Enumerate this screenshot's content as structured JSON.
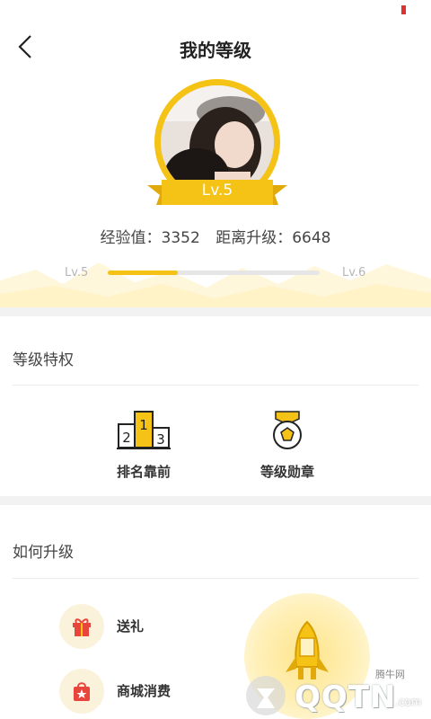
{
  "nav": {
    "title": "我的等级"
  },
  "profile": {
    "badge_level": "Lv.5"
  },
  "experience": {
    "exp_label": "经验值：3352",
    "remaining_label": "距离升级：6648",
    "current_level": "Lv.5",
    "next_level": "Lv.6",
    "progress_fraction": 0.33
  },
  "privileges": {
    "title": "等级特权",
    "items": [
      {
        "label": "排名靠前",
        "icon": "podium-icon"
      },
      {
        "label": "等级勋章",
        "icon": "medal-icon"
      }
    ],
    "podium_numbers": [
      "1",
      "2",
      "3"
    ]
  },
  "upgrade": {
    "title": "如何升级",
    "items": [
      {
        "label": "送礼",
        "icon": "gift-icon"
      },
      {
        "label": "商城消费",
        "icon": "shopping-bag-icon"
      }
    ]
  },
  "watermark": {
    "text": "QQTN",
    "small": "腾牛网",
    "suffix": ".com"
  },
  "colors": {
    "accent": "#f5c316",
    "background_band": "#f2f2f2",
    "icon_bg": "#fbf2dc",
    "battery": "#e03030"
  }
}
